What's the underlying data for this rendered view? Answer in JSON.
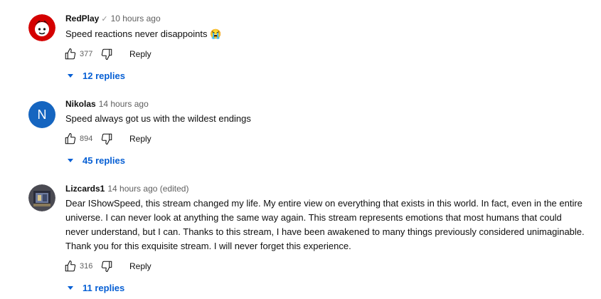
{
  "comments": [
    {
      "author": "RedPlay",
      "verified": "✓",
      "time": "10 hours ago",
      "text": "Speed reactions never disappoints 😭",
      "likes": "377",
      "reply_label": "Reply",
      "replies_label": "12 replies",
      "avatar_color": "#cc0000"
    },
    {
      "author": "Nikolas",
      "time": "14 hours ago",
      "text": "Speed always got us with the wildest endings",
      "likes": "894",
      "reply_label": "Reply",
      "replies_label": "45 replies",
      "avatar_letter": "N",
      "avatar_color": "#1565c0"
    },
    {
      "author": "Lizcards1",
      "time": "14 hours ago (edited)",
      "text": "Dear IShowSpeed, this stream changed my life. My entire view on everything that exists in this world. In fact, even in the entire universe. I can never look at anything the same way again. This stream represents emotions that most humans that could never understand, but I can. Thanks to this stream, I have been awakened to many things previously considered unimaginable. Thank you for this exquisite stream. I will never forget this experience.",
      "likes": "316",
      "reply_label": "Reply",
      "replies_label": "11 replies",
      "avatar_color": "#3b3b4a"
    }
  ],
  "colors": {
    "link": "#065fd4",
    "meta": "#606060"
  }
}
